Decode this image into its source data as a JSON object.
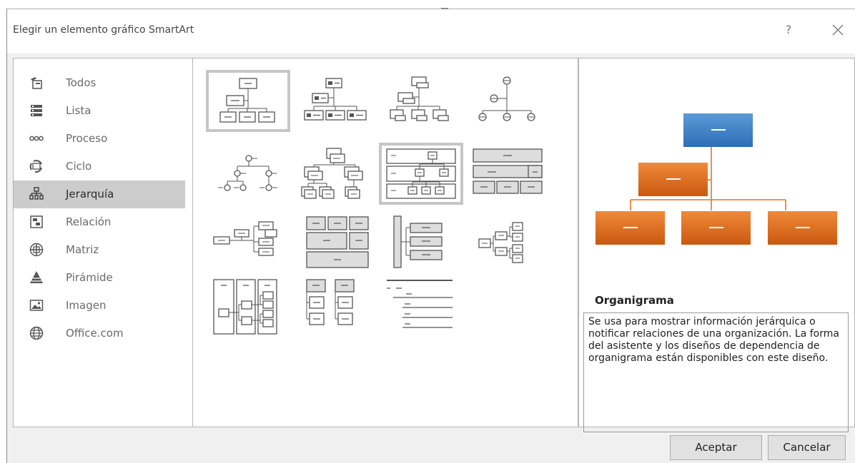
{
  "dialog": {
    "title": "Elegir un elemento gráfico SmartArt",
    "help_label": "?",
    "close_icon": "close-icon"
  },
  "categories": [
    {
      "label": "Todos",
      "icon": "all-icon"
    },
    {
      "label": "Lista",
      "icon": "list-icon"
    },
    {
      "label": "Proceso",
      "icon": "process-icon"
    },
    {
      "label": "Ciclo",
      "icon": "cycle-icon"
    },
    {
      "label": "Jerarquía",
      "icon": "hierarchy-icon",
      "selected": true
    },
    {
      "label": "Relación",
      "icon": "relationship-icon"
    },
    {
      "label": "Matriz",
      "icon": "matrix-icon"
    },
    {
      "label": "Pirámide",
      "icon": "pyramid-icon"
    },
    {
      "label": "Imagen",
      "icon": "picture-icon"
    },
    {
      "label": "Office.com",
      "icon": "globe-icon"
    }
  ],
  "layouts_selected_index": 0,
  "preview": {
    "title": "Organigrama",
    "description": "Se usa para mostrar información jerárquica o notificar relaciones de una organización. La forma del asistente y los diseños de dependencia de organigrama están disponibles con este diseño.",
    "colors": {
      "top": "#3e7cc4",
      "assistant": "#e06c1f",
      "line": "#e8843a"
    }
  },
  "buttons": {
    "ok": "Aceptar",
    "cancel": "Cancelar"
  }
}
